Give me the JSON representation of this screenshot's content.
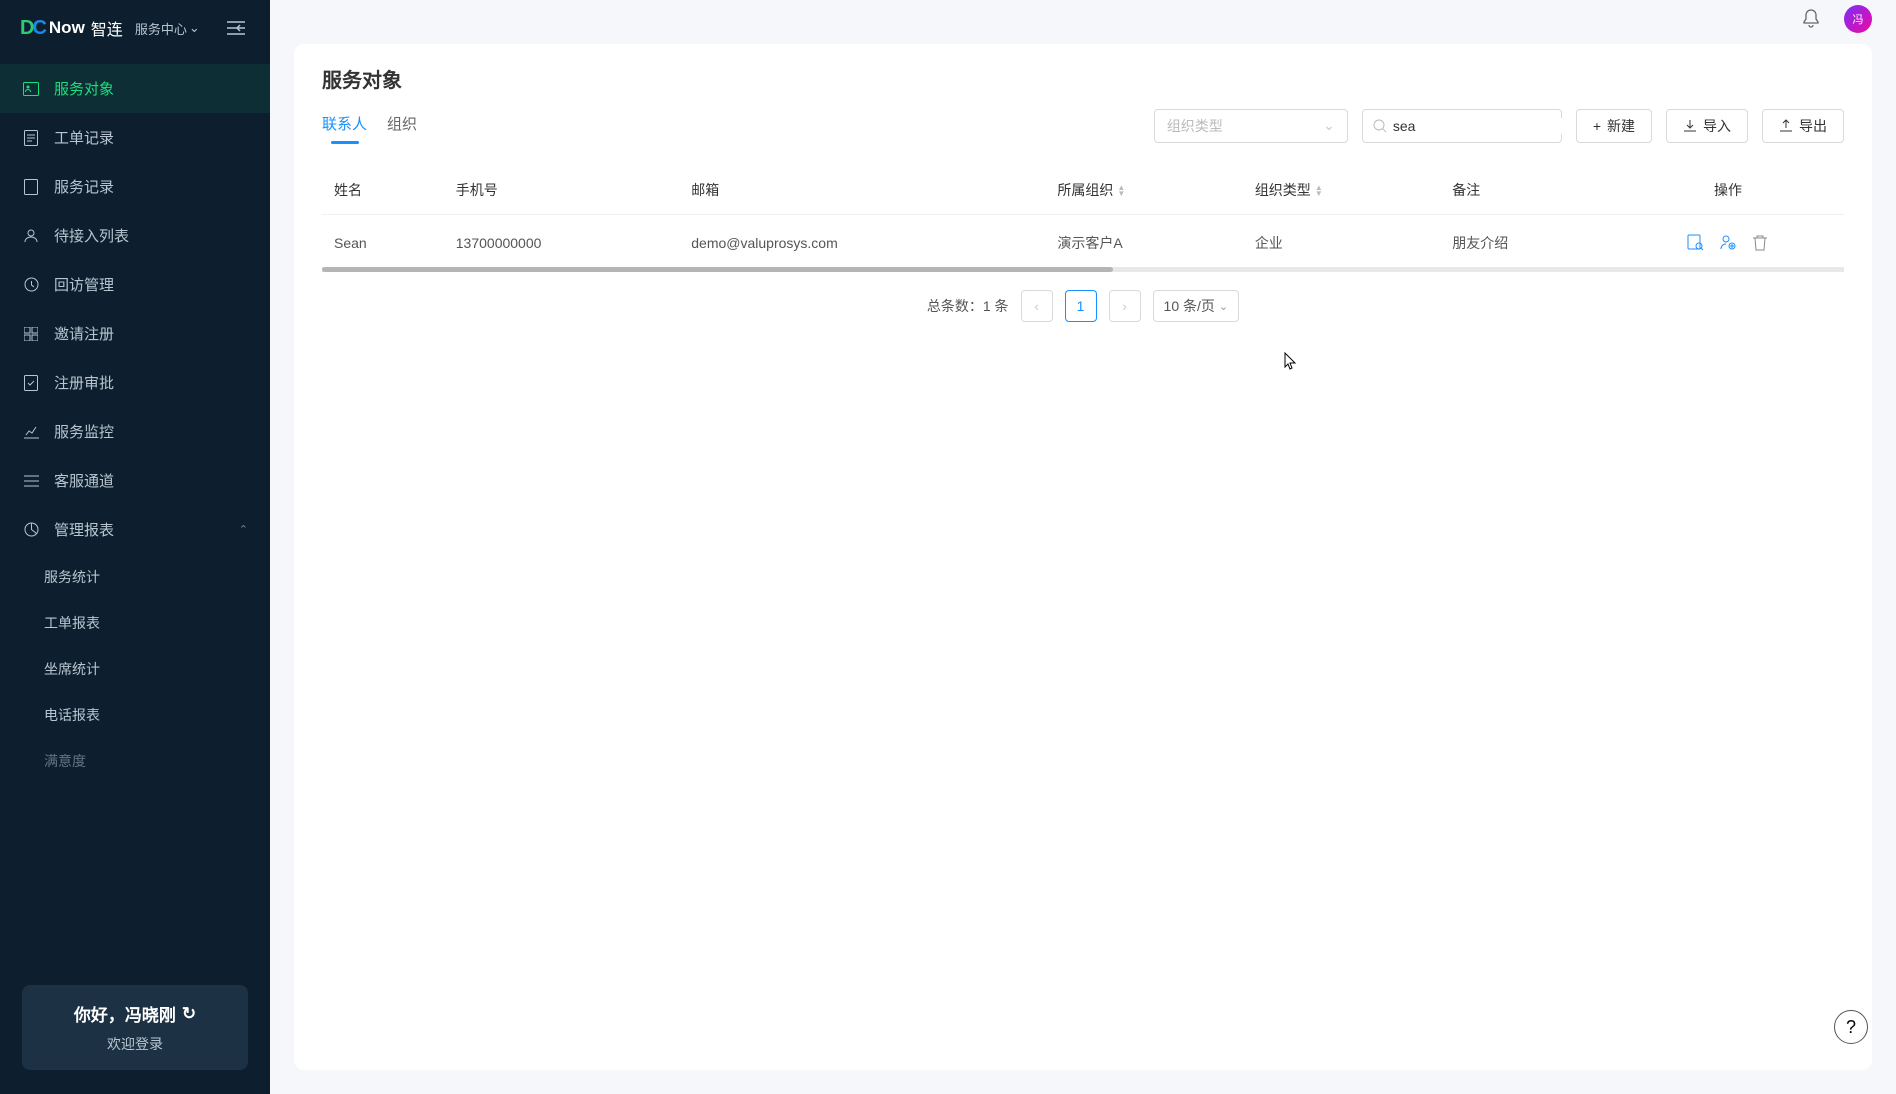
{
  "brand": {
    "d": "D",
    "c": "C",
    "now": "Now",
    "cn": "智连"
  },
  "service_center": "服务中心",
  "sidebar": {
    "items": [
      {
        "label": "服务对象"
      },
      {
        "label": "工单记录"
      },
      {
        "label": "服务记录"
      },
      {
        "label": "待接入列表"
      },
      {
        "label": "回访管理"
      },
      {
        "label": "邀请注册"
      },
      {
        "label": "注册审批"
      },
      {
        "label": "服务监控"
      },
      {
        "label": "客服通道"
      },
      {
        "label": "管理报表"
      }
    ],
    "report_sub": [
      {
        "label": "服务统计"
      },
      {
        "label": "工单报表"
      },
      {
        "label": "坐席统计"
      },
      {
        "label": "电话报表"
      },
      {
        "label": "满意度"
      }
    ]
  },
  "user": {
    "greeting": "你好，冯晓刚",
    "welcome": "欢迎登录"
  },
  "page": {
    "title": "服务对象"
  },
  "tabs": {
    "contacts": "联系人",
    "org": "组织"
  },
  "filters": {
    "org_type_placeholder": "组织类型",
    "search_value": "sea"
  },
  "buttons": {
    "new": "新建",
    "import": "导入",
    "export": "导出"
  },
  "table": {
    "headers": {
      "name": "姓名",
      "phone": "手机号",
      "email": "邮箱",
      "org": "所属组织",
      "org_type": "组织类型",
      "remark": "备注",
      "actions": "操作"
    },
    "rows": [
      {
        "name": "Sean",
        "phone": "13700000000",
        "email": "demo@valuprosys.com",
        "org": "演示客户A",
        "org_type": "企业",
        "remark": "朋友介绍"
      }
    ]
  },
  "pagination": {
    "total_label": "总条数：1 条",
    "current": "1",
    "page_size": "10 条/页"
  }
}
